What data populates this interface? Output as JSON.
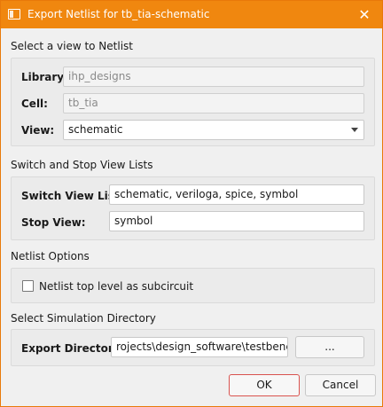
{
  "window": {
    "title": "Export Netlist for tb_tia-schematic",
    "close_glyph": "✕"
  },
  "view_section": {
    "title": "Select a view to Netlist",
    "library_label": "Library:",
    "library_value": "ihp_designs",
    "cell_label": "Cell:",
    "cell_value": "tb_tia",
    "view_label": "View:",
    "view_value": "schematic"
  },
  "lists_section": {
    "title": "Switch and Stop View Lists",
    "switch_label": "Switch View List:",
    "switch_value": "schematic, veriloga, spice, symbol",
    "stop_label": "Stop View:",
    "stop_value": "symbol"
  },
  "options_section": {
    "title": "Netlist Options",
    "subcircuit_label": "Netlist top level as subcircuit",
    "subcircuit_checked": false
  },
  "dir_section": {
    "title": "Select Simulation Directory",
    "export_label": "Export Directory:",
    "export_value": "rojects\\design_software\\testbenches",
    "browse_label": "..."
  },
  "buttons": {
    "ok": "OK",
    "cancel": "Cancel"
  }
}
